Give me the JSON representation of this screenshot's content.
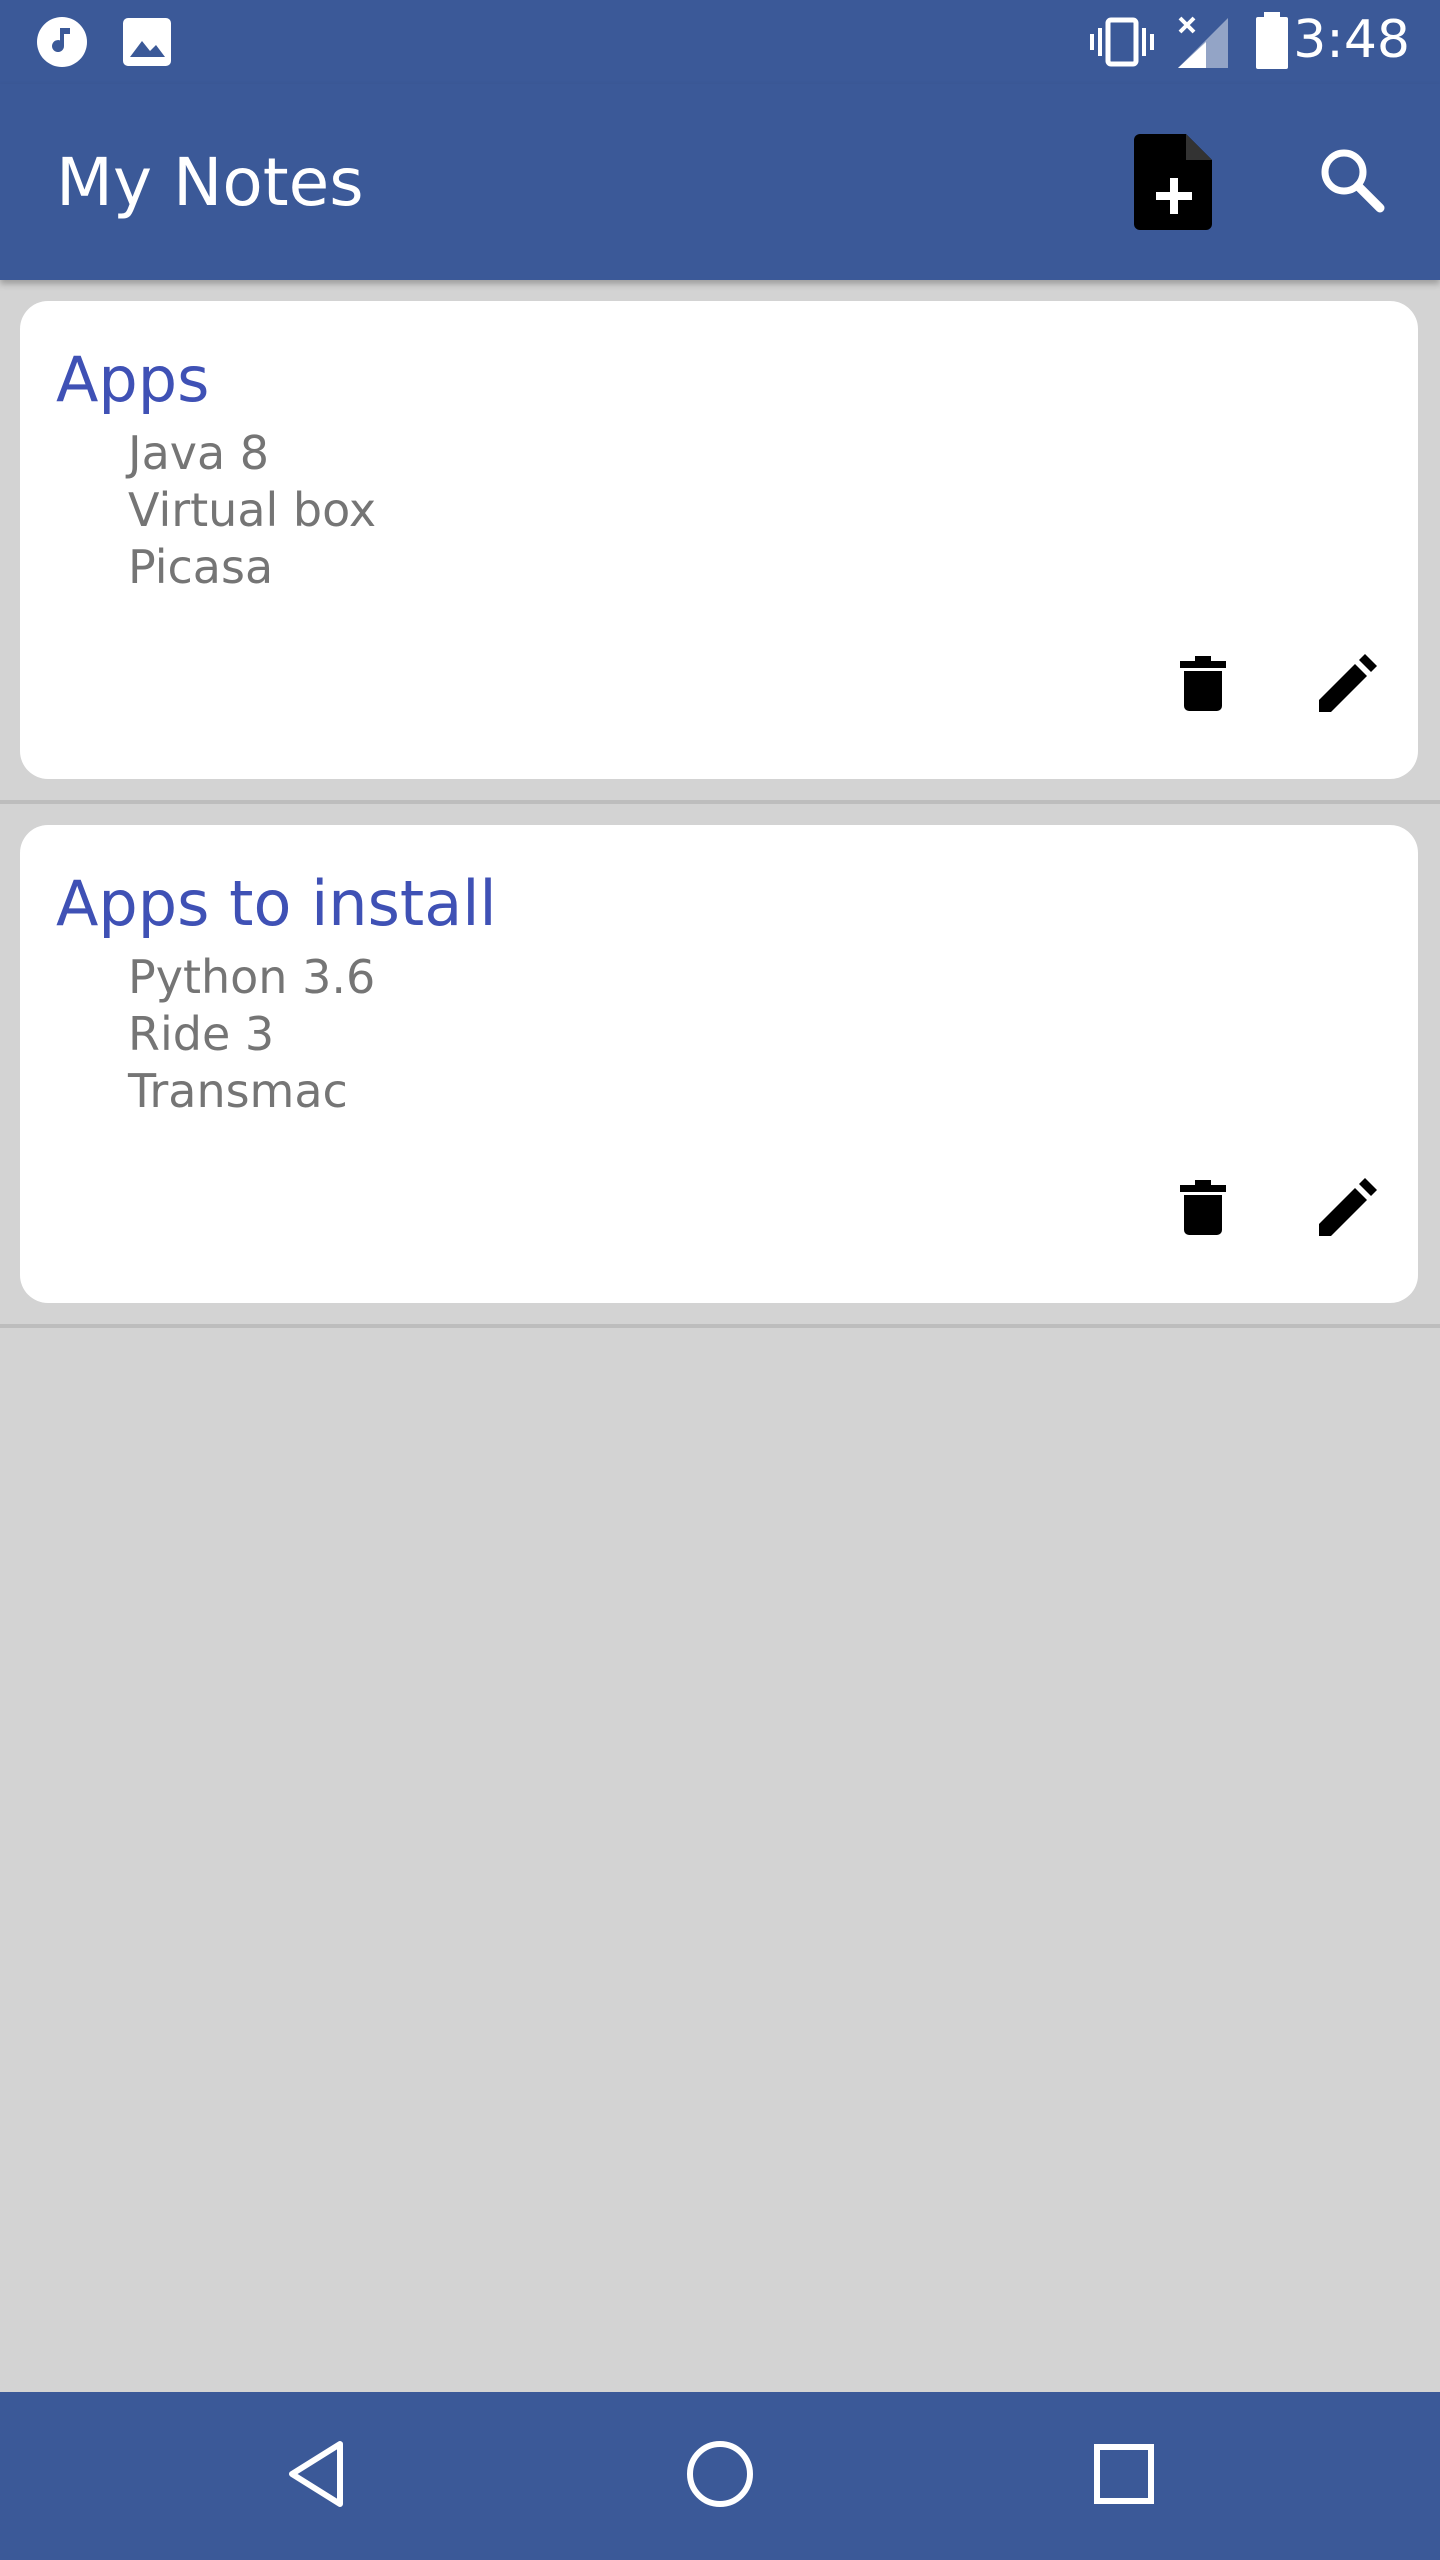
{
  "status_bar": {
    "time": "3:48",
    "left_icons": [
      "music-note-icon",
      "image-icon"
    ],
    "right_icons": [
      "vibrate-icon",
      "signal-off-icon",
      "battery-icon"
    ]
  },
  "app_bar": {
    "title": "My Notes",
    "actions": [
      "add-note-icon",
      "search-icon"
    ]
  },
  "notes": [
    {
      "title": "Apps",
      "lines": [
        "Java 8",
        "Virtual box",
        "Picasa"
      ],
      "actions": [
        "delete-icon",
        "edit-icon"
      ]
    },
    {
      "title": "Apps to install",
      "lines": [
        "Python 3.6",
        "Ride 3",
        "Transmac"
      ],
      "actions": [
        "delete-icon",
        "edit-icon"
      ]
    }
  ],
  "nav_bar": {
    "buttons": [
      "back-icon",
      "home-icon",
      "recents-icon"
    ]
  },
  "colors": {
    "primary": "#3b5998",
    "note_title": "#3f51b5",
    "note_text": "#757575",
    "background": "#d3d3d3"
  }
}
